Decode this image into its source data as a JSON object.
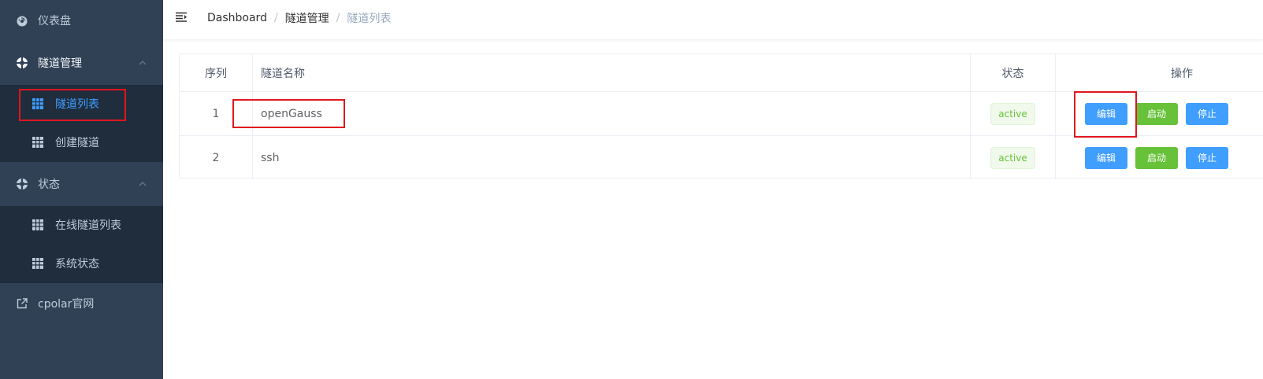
{
  "sidebar": {
    "dashboard": {
      "label": "仪表盘",
      "icon": "dashboard-icon"
    },
    "tunnel_mgmt": {
      "label": "隧道管理",
      "icon": "lifebuoy-icon"
    },
    "tunnel_list": {
      "label": "隧道列表",
      "icon": "table-icon"
    },
    "create_tunnel": {
      "label": "创建隧道",
      "icon": "table-icon"
    },
    "status": {
      "label": "状态",
      "icon": "lifebuoy-icon"
    },
    "online_tunnels": {
      "label": "在线隧道列表",
      "icon": "table-icon"
    },
    "system_status": {
      "label": "系统状态",
      "icon": "table-icon"
    },
    "cpolar_site": {
      "label": "cpolar官网",
      "icon": "external-link-icon"
    }
  },
  "header": {
    "breadcrumb": [
      "Dashboard",
      "隧道管理",
      "隧道列表"
    ],
    "separator": "/"
  },
  "table": {
    "columns": [
      "序列",
      "隧道名称",
      "状态",
      "操作"
    ],
    "rows": [
      {
        "index": "1",
        "name": "openGauss",
        "status": "active"
      },
      {
        "index": "2",
        "name": "ssh",
        "status": "active"
      }
    ],
    "actions": {
      "edit": "编辑",
      "start": "启动",
      "stop": "停止"
    }
  },
  "colors": {
    "sidebar_bg": "#304156",
    "submenu_bg": "#1f2d3d",
    "primary": "#409eff",
    "success": "#67c23a",
    "annotation": "#e0161d"
  }
}
